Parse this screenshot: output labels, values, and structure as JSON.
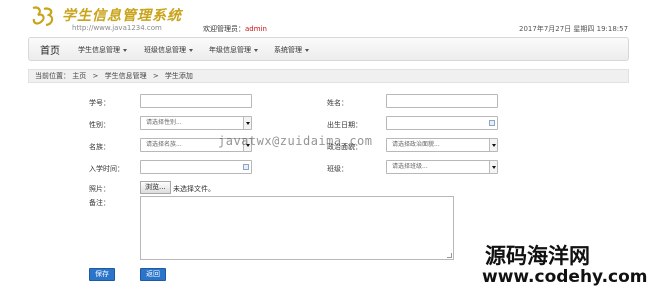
{
  "header": {
    "title": "学生信息管理系统",
    "url": "http://www.java1234.com",
    "welcome_prefix": "欢迎管理员：",
    "user": "admin",
    "datetime": "2017年7月27日 星期四 19:18:57"
  },
  "nav": {
    "home": "首页",
    "items": [
      {
        "label": "学生信息管理"
      },
      {
        "label": "班级信息管理"
      },
      {
        "label": "年级信息管理"
      },
      {
        "label": "系统管理"
      }
    ]
  },
  "breadcrumb": {
    "prefix": "当前位置：",
    "items": [
      "主页",
      "学生信息管理",
      "学生添加"
    ],
    "separator": ">"
  },
  "form": {
    "student_no": {
      "label": "学号：",
      "value": ""
    },
    "name": {
      "label": "姓名：",
      "value": ""
    },
    "gender": {
      "label": "性别：",
      "placeholder": "请选择性别..."
    },
    "birthday": {
      "label": "出生日期：",
      "value": ""
    },
    "ethnicity": {
      "label": "名族：",
      "placeholder": "请选择名族..."
    },
    "politics": {
      "label": "政治面貌：",
      "placeholder": "请选择政治面貌..."
    },
    "enroll_time": {
      "label": "入学时间：",
      "value": ""
    },
    "class": {
      "label": "班级：",
      "placeholder": "请选择班级..."
    },
    "photo": {
      "label": "照片：",
      "button": "浏览...",
      "status": "未选择文件。"
    },
    "remark": {
      "label": "备注："
    },
    "save": "保存",
    "back": "返回"
  },
  "watermarks": {
    "email": "javatwx@zuidaima.com",
    "site_name": "源码海洋网",
    "site_url": "www.codehy.com"
  },
  "colors": {
    "title": "#c9a31a",
    "admin": "#d01010",
    "button": "#2a74c9"
  }
}
